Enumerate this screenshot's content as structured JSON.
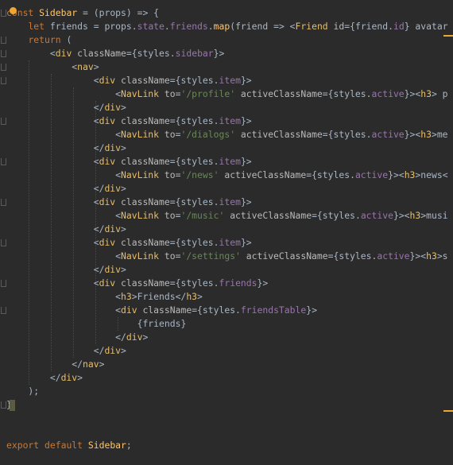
{
  "code": {
    "lines": [
      [
        {
          "t": "const",
          "c": "kw"
        },
        {
          "t": " "
        },
        {
          "t": "Sidebar",
          "c": "fn"
        },
        {
          "t": " = (props) => {"
        }
      ],
      [
        {
          "t": "    "
        },
        {
          "t": "let",
          "c": "kw"
        },
        {
          "t": " friends = props."
        },
        {
          "t": "state",
          "c": "prop"
        },
        {
          "t": "."
        },
        {
          "t": "friends",
          "c": "prop"
        },
        {
          "t": "."
        },
        {
          "t": "map",
          "c": "fn"
        },
        {
          "t": "(friend => <"
        },
        {
          "t": "Friend",
          "c": "tag"
        },
        {
          "t": " "
        },
        {
          "t": "id",
          "c": "attr"
        },
        {
          "t": "={friend."
        },
        {
          "t": "id",
          "c": "prop"
        },
        {
          "t": "} avatar"
        }
      ],
      [
        {
          "t": "    "
        },
        {
          "t": "return",
          "c": "kw"
        },
        {
          "t": " ("
        }
      ],
      [
        {
          "t": "        <"
        },
        {
          "t": "div",
          "c": "tag"
        },
        {
          "t": " "
        },
        {
          "t": "className",
          "c": "attr"
        },
        {
          "t": "={styles."
        },
        {
          "t": "sidebar",
          "c": "prop"
        },
        {
          "t": "}>"
        }
      ],
      [
        {
          "t": "            <"
        },
        {
          "t": "nav",
          "c": "tag"
        },
        {
          "t": ">"
        }
      ],
      [
        {
          "t": "                <"
        },
        {
          "t": "div",
          "c": "tag"
        },
        {
          "t": " "
        },
        {
          "t": "className",
          "c": "attr"
        },
        {
          "t": "={styles."
        },
        {
          "t": "item",
          "c": "prop"
        },
        {
          "t": "}>"
        }
      ],
      [
        {
          "t": "                    <"
        },
        {
          "t": "NavLink",
          "c": "tag"
        },
        {
          "t": " "
        },
        {
          "t": "to",
          "c": "attr"
        },
        {
          "t": "="
        },
        {
          "t": "'/profile'",
          "c": "str"
        },
        {
          "t": " "
        },
        {
          "t": "activeClassName",
          "c": "attr"
        },
        {
          "t": "={styles."
        },
        {
          "t": "active",
          "c": "prop"
        },
        {
          "t": "}><"
        },
        {
          "t": "h3",
          "c": "tag"
        },
        {
          "t": "> p"
        }
      ],
      [
        {
          "t": "                </"
        },
        {
          "t": "div",
          "c": "tag"
        },
        {
          "t": ">"
        }
      ],
      [
        {
          "t": "                <"
        },
        {
          "t": "div",
          "c": "tag"
        },
        {
          "t": " "
        },
        {
          "t": "className",
          "c": "attr"
        },
        {
          "t": "={styles."
        },
        {
          "t": "item",
          "c": "prop"
        },
        {
          "t": "}>"
        }
      ],
      [
        {
          "t": "                    <"
        },
        {
          "t": "NavLink",
          "c": "tag"
        },
        {
          "t": " "
        },
        {
          "t": "to",
          "c": "attr"
        },
        {
          "t": "="
        },
        {
          "t": "'/dialogs'",
          "c": "str"
        },
        {
          "t": " "
        },
        {
          "t": "activeClassName",
          "c": "attr"
        },
        {
          "t": "={styles."
        },
        {
          "t": "active",
          "c": "prop"
        },
        {
          "t": "}><"
        },
        {
          "t": "h3",
          "c": "tag"
        },
        {
          "t": ">me"
        }
      ],
      [
        {
          "t": "                </"
        },
        {
          "t": "div",
          "c": "tag"
        },
        {
          "t": ">"
        }
      ],
      [
        {
          "t": "                <"
        },
        {
          "t": "div",
          "c": "tag"
        },
        {
          "t": " "
        },
        {
          "t": "className",
          "c": "attr"
        },
        {
          "t": "={styles."
        },
        {
          "t": "item",
          "c": "prop"
        },
        {
          "t": "}>"
        }
      ],
      [
        {
          "t": "                    <"
        },
        {
          "t": "NavLink",
          "c": "tag"
        },
        {
          "t": " "
        },
        {
          "t": "to",
          "c": "attr"
        },
        {
          "t": "="
        },
        {
          "t": "'/news'",
          "c": "str"
        },
        {
          "t": " "
        },
        {
          "t": "activeClassName",
          "c": "attr"
        },
        {
          "t": "={styles."
        },
        {
          "t": "active",
          "c": "prop"
        },
        {
          "t": "}><"
        },
        {
          "t": "h3",
          "c": "tag"
        },
        {
          "t": ">news<"
        }
      ],
      [
        {
          "t": "                </"
        },
        {
          "t": "div",
          "c": "tag"
        },
        {
          "t": ">"
        }
      ],
      [
        {
          "t": "                <"
        },
        {
          "t": "div",
          "c": "tag"
        },
        {
          "t": " "
        },
        {
          "t": "className",
          "c": "attr"
        },
        {
          "t": "={styles."
        },
        {
          "t": "item",
          "c": "prop"
        },
        {
          "t": "}>"
        }
      ],
      [
        {
          "t": "                    <"
        },
        {
          "t": "NavLink",
          "c": "tag"
        },
        {
          "t": " "
        },
        {
          "t": "to",
          "c": "attr"
        },
        {
          "t": "="
        },
        {
          "t": "'/music'",
          "c": "str"
        },
        {
          "t": " "
        },
        {
          "t": "activeClassName",
          "c": "attr"
        },
        {
          "t": "={styles."
        },
        {
          "t": "active",
          "c": "prop"
        },
        {
          "t": "}><"
        },
        {
          "t": "h3",
          "c": "tag"
        },
        {
          "t": ">musi"
        }
      ],
      [
        {
          "t": "                </"
        },
        {
          "t": "div",
          "c": "tag"
        },
        {
          "t": ">"
        }
      ],
      [
        {
          "t": "                <"
        },
        {
          "t": "div",
          "c": "tag"
        },
        {
          "t": " "
        },
        {
          "t": "className",
          "c": "attr"
        },
        {
          "t": "={styles."
        },
        {
          "t": "item",
          "c": "prop"
        },
        {
          "t": "}>"
        }
      ],
      [
        {
          "t": "                    <"
        },
        {
          "t": "NavLink",
          "c": "tag"
        },
        {
          "t": " "
        },
        {
          "t": "to",
          "c": "attr"
        },
        {
          "t": "="
        },
        {
          "t": "'/settings'",
          "c": "str"
        },
        {
          "t": " "
        },
        {
          "t": "activeClassName",
          "c": "attr"
        },
        {
          "t": "={styles."
        },
        {
          "t": "active",
          "c": "prop"
        },
        {
          "t": "}><"
        },
        {
          "t": "h3",
          "c": "tag"
        },
        {
          "t": ">s"
        }
      ],
      [
        {
          "t": "                </"
        },
        {
          "t": "div",
          "c": "tag"
        },
        {
          "t": ">"
        }
      ],
      [
        {
          "t": "                <"
        },
        {
          "t": "div",
          "c": "tag"
        },
        {
          "t": " "
        },
        {
          "t": "className",
          "c": "attr"
        },
        {
          "t": "={styles."
        },
        {
          "t": "friends",
          "c": "prop"
        },
        {
          "t": "}>"
        }
      ],
      [
        {
          "t": "                    <"
        },
        {
          "t": "h3",
          "c": "tag"
        },
        {
          "t": ">Friends</"
        },
        {
          "t": "h3",
          "c": "tag"
        },
        {
          "t": ">"
        }
      ],
      [
        {
          "t": "                    <"
        },
        {
          "t": "div",
          "c": "tag"
        },
        {
          "t": " "
        },
        {
          "t": "className",
          "c": "attr"
        },
        {
          "t": "={styles."
        },
        {
          "t": "friendsTable",
          "c": "prop"
        },
        {
          "t": "}>"
        }
      ],
      [
        {
          "t": "                        {friends}"
        }
      ],
      [
        {
          "t": "                    </"
        },
        {
          "t": "div",
          "c": "tag"
        },
        {
          "t": ">"
        }
      ],
      [
        {
          "t": "                </"
        },
        {
          "t": "div",
          "c": "tag"
        },
        {
          "t": ">"
        }
      ],
      [
        {
          "t": "            </"
        },
        {
          "t": "nav",
          "c": "tag"
        },
        {
          "t": ">"
        }
      ],
      [
        {
          "t": "        </"
        },
        {
          "t": "div",
          "c": "tag"
        },
        {
          "t": ">"
        }
      ],
      [
        {
          "t": "    );"
        }
      ],
      [
        {
          "t": "}"
        }
      ],
      [
        {
          "t": ""
        }
      ],
      [
        {
          "t": ""
        }
      ],
      [
        {
          "t": "export",
          "c": "kw"
        },
        {
          "t": " "
        },
        {
          "t": "default",
          "c": "kw"
        },
        {
          "t": " "
        },
        {
          "t": "Sidebar",
          "c": "fn"
        },
        {
          "t": ";"
        }
      ]
    ]
  }
}
